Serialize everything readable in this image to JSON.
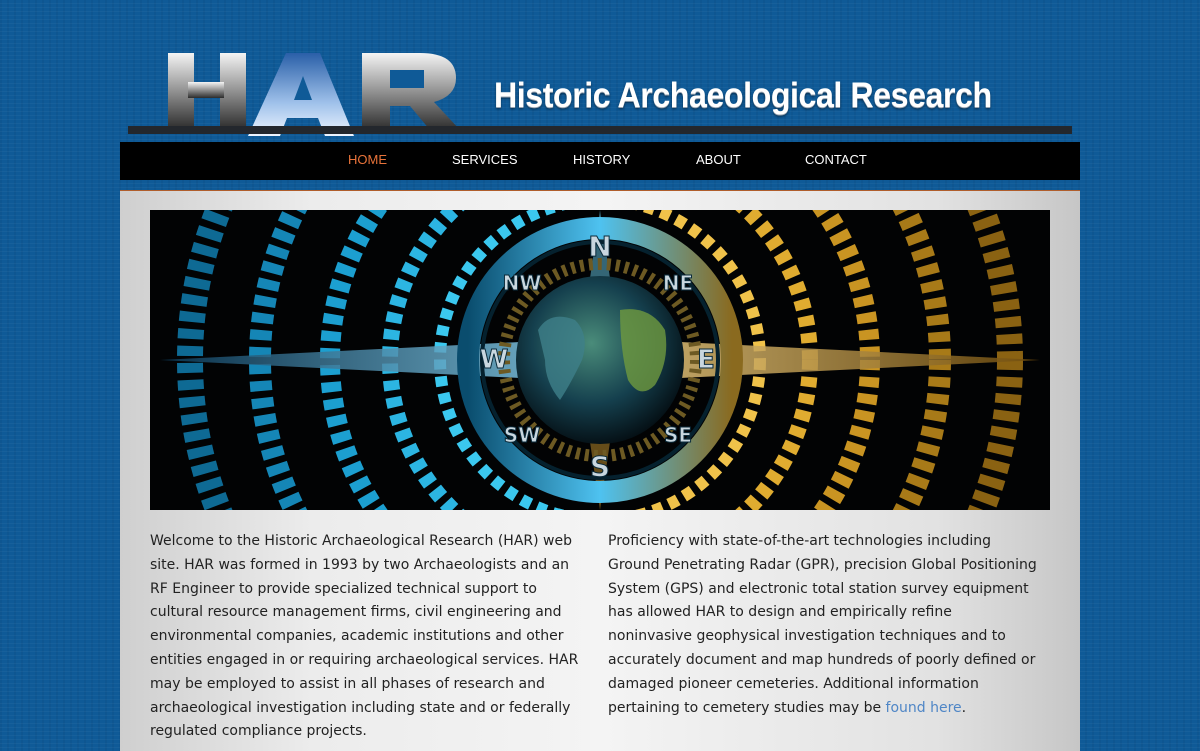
{
  "header": {
    "logo_text": "HAR",
    "site_title": "Historic Archaeological Research"
  },
  "nav": {
    "items": [
      {
        "label": "HOME",
        "active": true
      },
      {
        "label": "SERVICES"
      },
      {
        "label": "HISTORY"
      },
      {
        "label": "ABOUT"
      },
      {
        "label": "CONTACT"
      }
    ]
  },
  "banner": {
    "icon": "compass-globe-image",
    "compass_labels": [
      "N",
      "NE",
      "E",
      "SE",
      "S",
      "SW",
      "W",
      "NW"
    ]
  },
  "main": {
    "left_paragraph": "Welcome to the Historic Archaeological Research (HAR) web site. HAR was formed in 1993 by two Archaeologists and an RF Engineer to provide specialized technical support to cultural resource management firms, civil engineering and environmental companies, academic institutions and other entities engaged in or requiring archaeological services. HAR may be employed to assist in all phases of research and archaeological investigation including state and or federally regulated compliance projects.",
    "right_paragraph_before_link": "Proficiency with state-of-the-art technologies including Ground Penetrating Radar (GPR), precision Global Positioning System (GPS) and electronic total station survey equipment has allowed HAR to design and empirically refine noninvasive geophysical investigation techniques and to accurately document and map hundreds of poorly defined or damaged pioneer cemeteries. Additional information pertaining to cemetery studies may be ",
    "right_link": "found here",
    "right_paragraph_after_link": "."
  },
  "colors": {
    "background": "#0f5a97",
    "nav_background": "#000000",
    "nav_active": "#e8733a",
    "link": "#4f86c6"
  }
}
